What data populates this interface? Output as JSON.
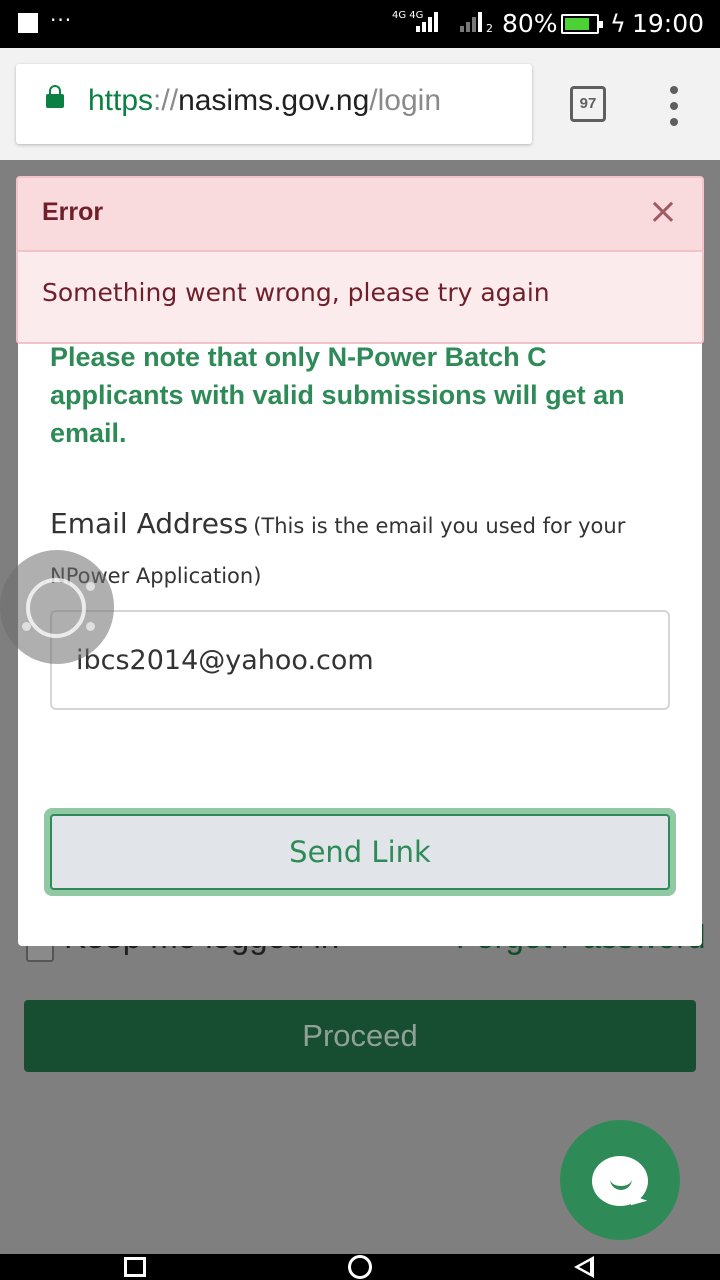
{
  "status_bar": {
    "network": "4G 4G",
    "sim_slot": "2",
    "battery": "80%",
    "time": "19:00",
    "more": "···"
  },
  "browser": {
    "url_scheme": "https",
    "url_sep": "://",
    "url_host": "nasims.gov.ng",
    "url_path": "/login",
    "tab_count": "97"
  },
  "alert": {
    "title": "Error",
    "close": "×",
    "message": "Something went wrong, please try again"
  },
  "modal": {
    "note": "Please note that only N-Power Batch C applicants with valid submissions will get an email.",
    "email_label": "Email Address",
    "email_hint": "(This is the email you used for your NPower Application)",
    "email_value": "ibcs2014@yahoo.com",
    "send_label": "Send Link"
  },
  "page": {
    "keep_logged_in": "Keep me logged in",
    "forgot_password": "Forgot Password",
    "proceed_label": "Proceed"
  },
  "colors": {
    "brand_green": "#2e8b57",
    "dark_green": "#174d31",
    "error_text": "#6e1f2a"
  }
}
